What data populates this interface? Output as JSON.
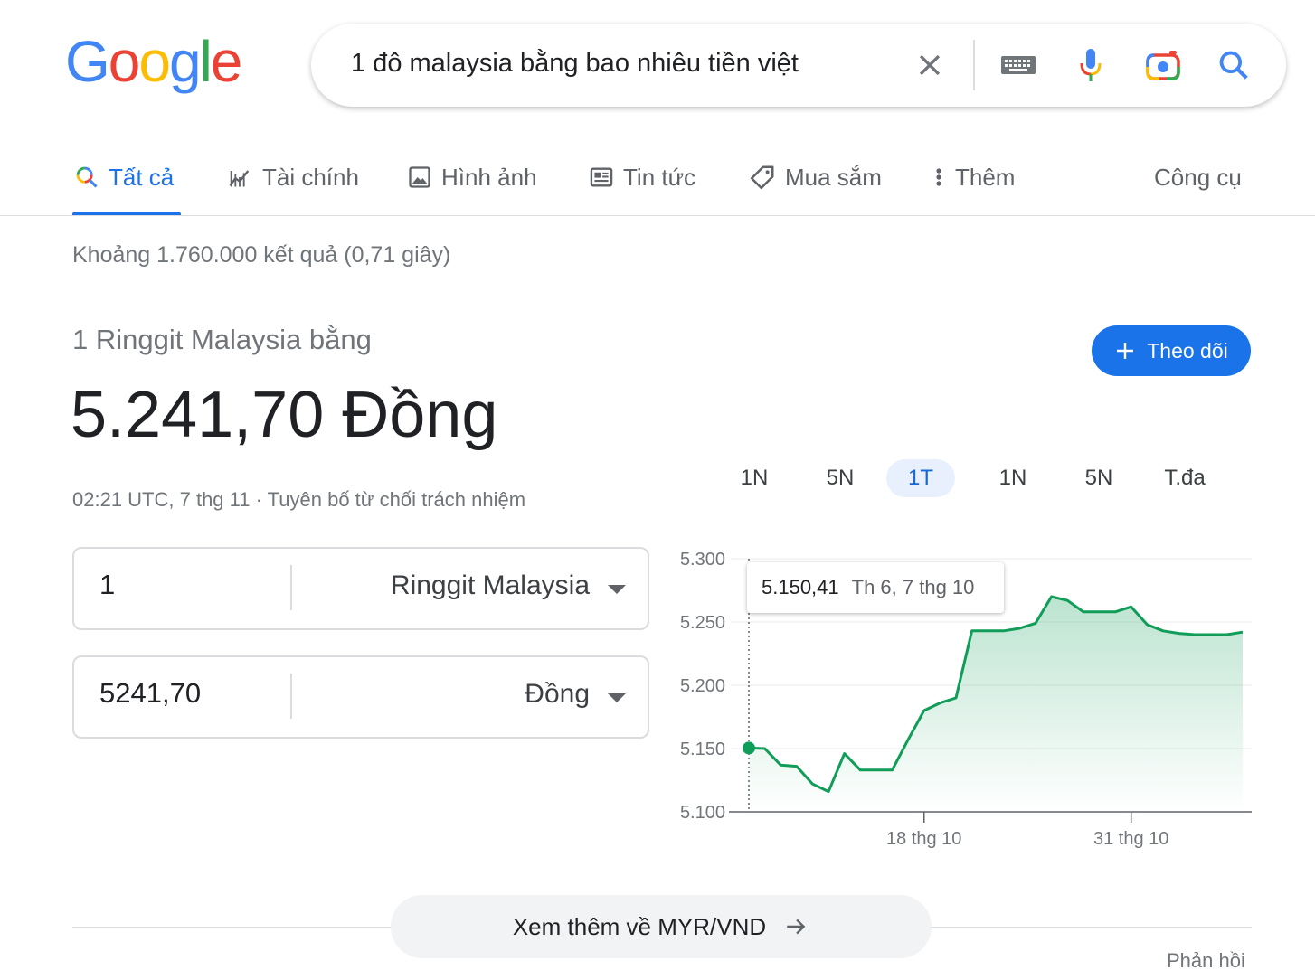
{
  "logo": {
    "letters": [
      "G",
      "o",
      "o",
      "g",
      "l",
      "e"
    ],
    "colors": [
      "#4285f4",
      "#ea4335",
      "#fbbc05",
      "#4285f4",
      "#34a853",
      "#ea4335"
    ]
  },
  "search": {
    "query": "1 đô malaysia bằng bao nhiêu tiền việt"
  },
  "tabs": [
    {
      "label": "Tất cả",
      "icon": "search-icon",
      "active": true
    },
    {
      "label": "Tài chính",
      "icon": "finance-chart-icon"
    },
    {
      "label": "Hình ảnh",
      "icon": "image-icon"
    },
    {
      "label": "Tin tức",
      "icon": "news-icon"
    },
    {
      "label": "Mua sắm",
      "icon": "tag-icon"
    },
    {
      "label": "Thêm",
      "icon": "more-vert-icon"
    }
  ],
  "tools_label": "Công cụ",
  "stats": "Khoảng 1.760.000 kết quả (0,71 giây)",
  "currency": {
    "subtitle": "1 Ringgit Malaysia bằng",
    "value": "5.241,70 Đồng",
    "timestamp": "02:21 UTC, 7 thg 11 · Tuyên bố từ chối trách nhiệm",
    "follow_label": "Theo dõi",
    "from": {
      "amount": "1",
      "currency": "Ringgit Malaysia"
    },
    "to": {
      "amount": "5241,70",
      "currency": "Đồng"
    }
  },
  "ranges": [
    "1N",
    "5N",
    "1T",
    "1N",
    "5N",
    "T.đa"
  ],
  "selected_range": "1T",
  "tooltip": {
    "value": "5.150,41",
    "date": "Th 6, 7 thg 10"
  },
  "more_label": "Xem thêm về MYR/VND",
  "feedback_label": "Phản hồi",
  "colors": {
    "accent": "#1a73e8",
    "line": "#0f9d58"
  },
  "chart_data": {
    "type": "area",
    "x": [
      "7 thg 10",
      "8 thg 10",
      "9 thg 10",
      "10 thg 10",
      "11 thg 10",
      "12 thg 10",
      "13 thg 10",
      "14 thg 10",
      "15 thg 10",
      "16 thg 10",
      "17 thg 10",
      "18 thg 10",
      "19 thg 10",
      "20 thg 10",
      "21 thg 10",
      "22 thg 10",
      "23 thg 10",
      "24 thg 10",
      "25 thg 10",
      "26 thg 10",
      "27 thg 10",
      "28 thg 10",
      "29 thg 10",
      "30 thg 10",
      "31 thg 10",
      "1 thg 11",
      "2 thg 11",
      "3 thg 11",
      "4 thg 11",
      "5 thg 11",
      "6 thg 11",
      "7 thg 11"
    ],
    "y": [
      5150.41,
      5150,
      5137,
      5136,
      5122,
      5116,
      5146,
      5133,
      5133,
      5133,
      5157,
      5180,
      5186,
      5190,
      5243,
      5243,
      5243,
      5245,
      5249,
      5270,
      5267,
      5258,
      5258,
      5258,
      5262,
      5248,
      5243,
      5241,
      5240,
      5240,
      5240,
      5242
    ],
    "xtick_labels": [
      "18 thg 10",
      "31 thg 10"
    ],
    "ytick_labels": [
      "5.300",
      "5.250",
      "5.200",
      "5.150",
      "5.100"
    ],
    "yticks": [
      5300,
      5250,
      5200,
      5150,
      5100
    ],
    "xticks": [
      "18 thg 10",
      "31 thg 10"
    ],
    "ylim": [
      5100,
      5300
    ],
    "grid": true
  }
}
